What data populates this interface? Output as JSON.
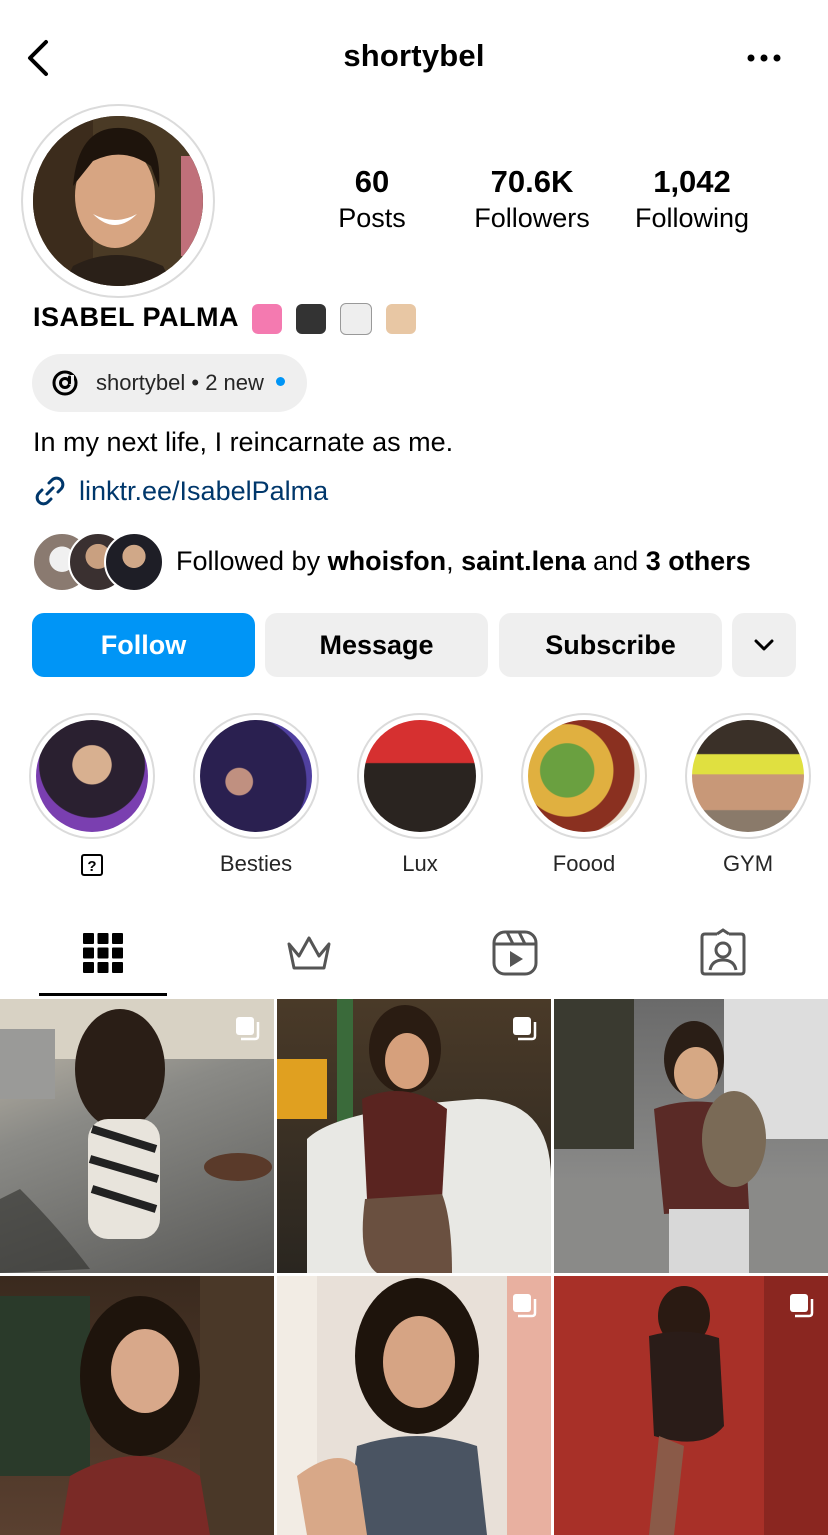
{
  "header": {
    "username": "shortybel"
  },
  "profile": {
    "stats": [
      {
        "value": "60",
        "label": "Posts"
      },
      {
        "value": "70.6K",
        "label": "Followers"
      },
      {
        "value": "1,042",
        "label": "Following"
      }
    ],
    "display_name": "ISABEL PALMA",
    "threads_badge": "shortybel • 2 new",
    "bio": "In my next life, I reincarnate as me.",
    "link": "linktr.ee/IsabelPalma",
    "followed_by": {
      "prefix": "Followed by ",
      "user1": "whoisfon",
      "sep": ", ",
      "user2": "saint.lena",
      "and": " and ",
      "others": "3 others"
    }
  },
  "actions": {
    "follow": "Follow",
    "message": "Message",
    "subscribe": "Subscribe"
  },
  "highlights": [
    {
      "label": "?",
      "icon": "question-box"
    },
    {
      "label": "Besties"
    },
    {
      "label": "Lux"
    },
    {
      "label": "Foood"
    },
    {
      "label": "GYM"
    }
  ],
  "tabs": [
    "grid-icon",
    "crown-icon",
    "reels-icon",
    "tagged-icon"
  ],
  "colors": {
    "accent": "#0095f6",
    "link": "#00376b",
    "secondary_bg": "#efefef"
  }
}
